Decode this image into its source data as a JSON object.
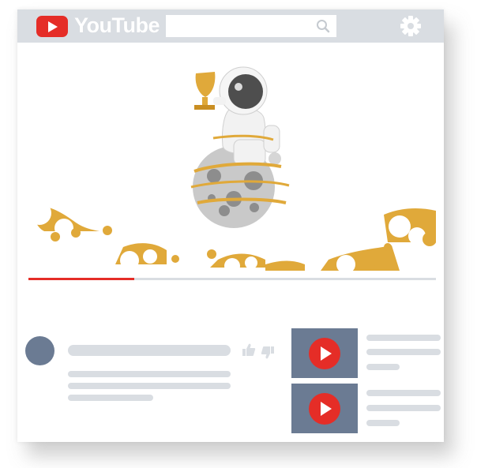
{
  "header": {
    "logo_text": "YouTube",
    "search_placeholder": ""
  },
  "player": {
    "progress_fraction": 0.26,
    "illustration": "astronaut-holding-trophy-on-moon"
  },
  "recommended": {
    "items": [
      {
        "thumbnail": "video-thumbnail"
      },
      {
        "thumbnail": "video-thumbnail"
      }
    ]
  },
  "colors": {
    "brand_red": "#e52d27",
    "topbar": "#d9dde2",
    "placeholder": "#d9dde2",
    "thumbnail": "#6b7b93",
    "gold": "#e0a93a"
  }
}
